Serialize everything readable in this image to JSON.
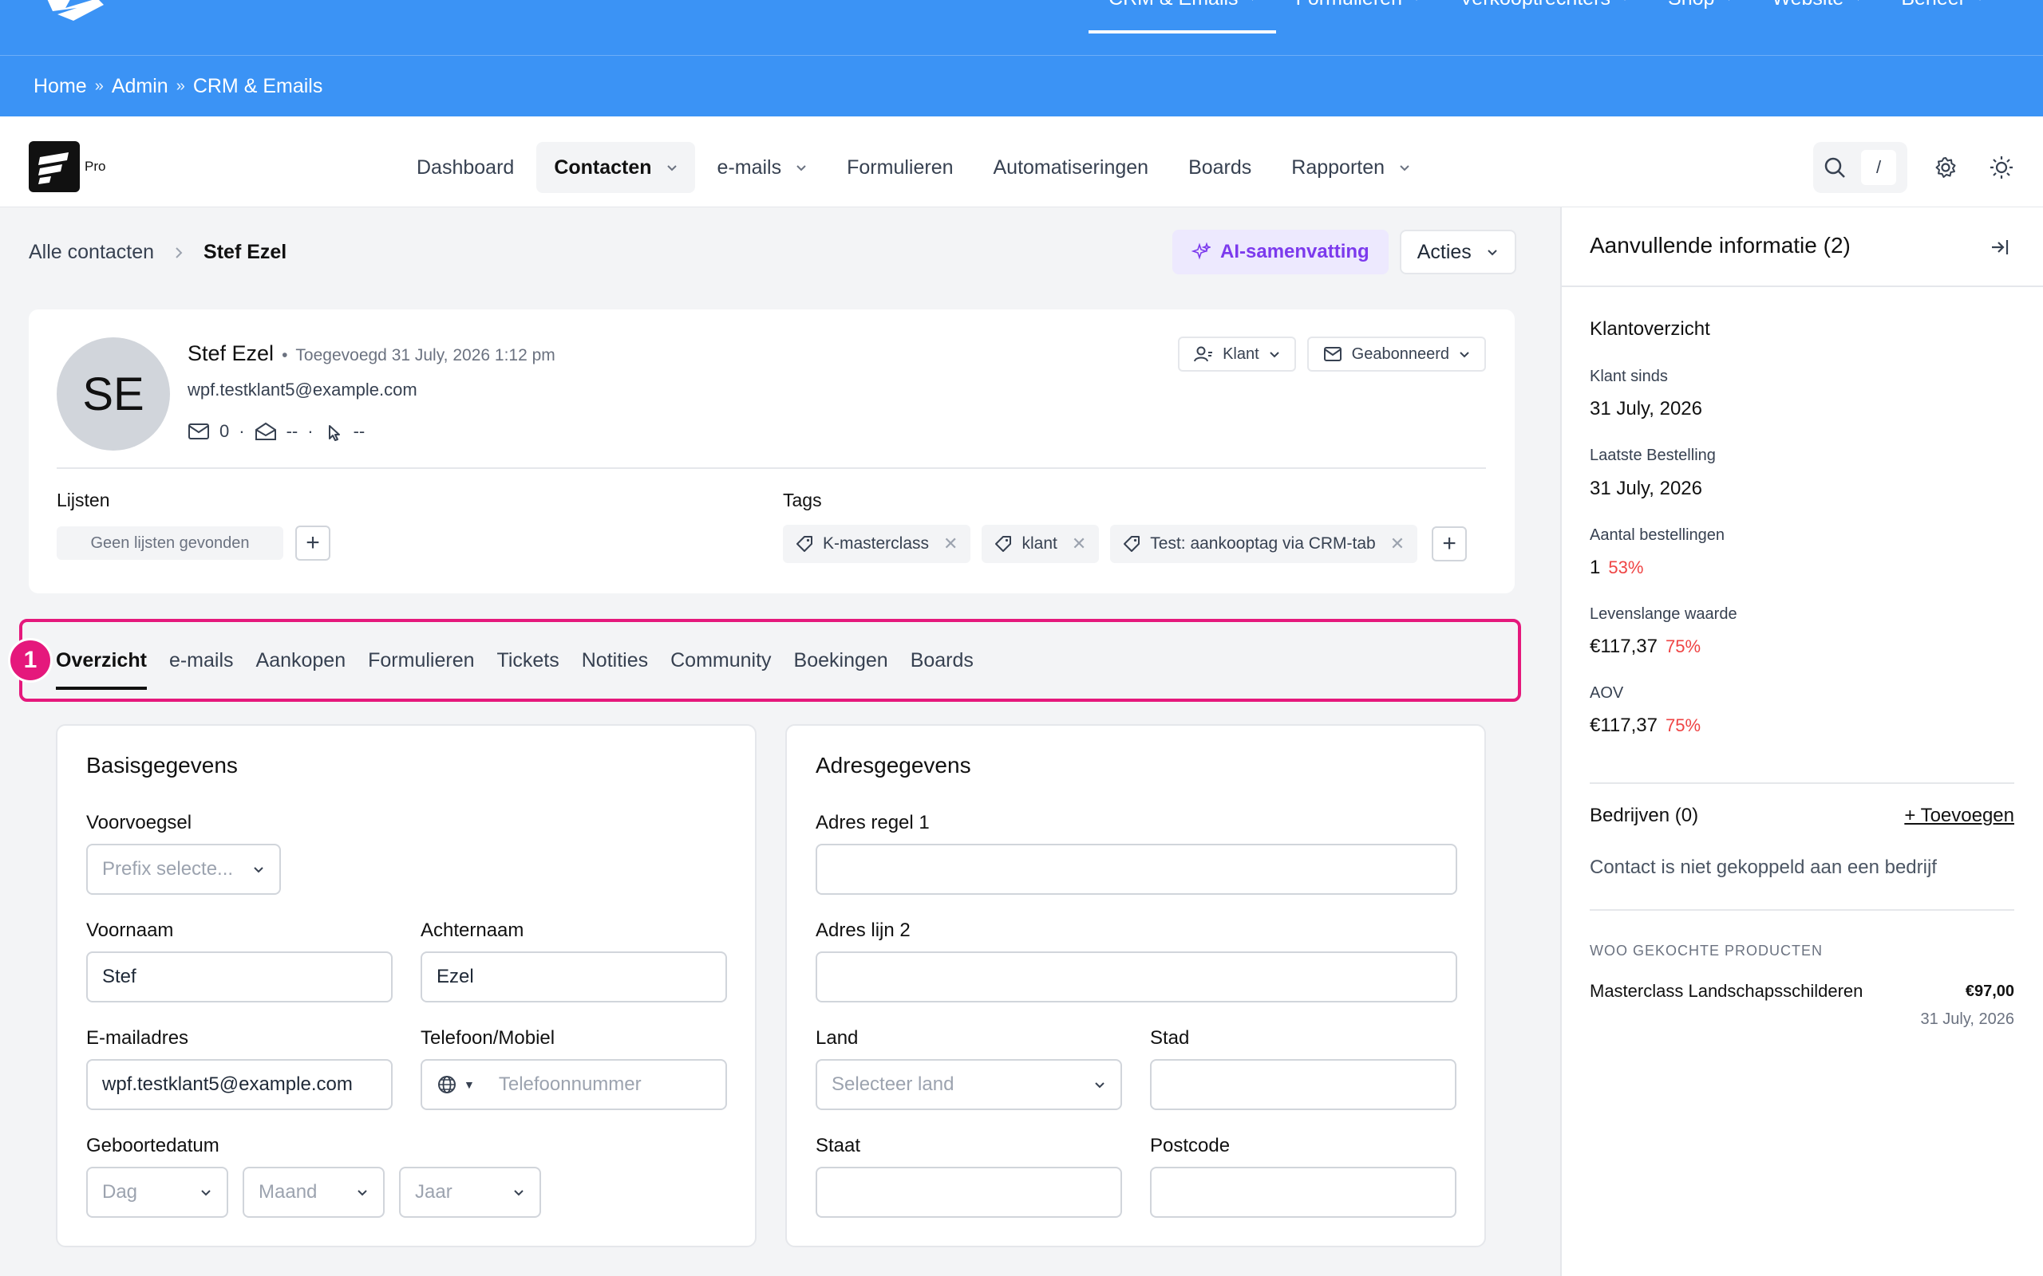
{
  "topnav": {
    "items": [
      {
        "label": "CRM & Emails",
        "active": true
      },
      {
        "label": "Formulieren"
      },
      {
        "label": "Verkooptrechters"
      },
      {
        "label": "Shop"
      },
      {
        "label": "Website"
      },
      {
        "label": "Beheer"
      }
    ]
  },
  "breadcrumb_bar": {
    "items": [
      "Home",
      "Admin",
      "CRM & Emails"
    ],
    "sep": "»"
  },
  "app": {
    "brand_suffix": "Pro",
    "nav": [
      {
        "label": "Dashboard"
      },
      {
        "label": "Contacten",
        "active": true
      },
      {
        "label": "e-mails"
      },
      {
        "label": "Formulieren"
      },
      {
        "label": "Automatiseringen"
      },
      {
        "label": "Boards"
      },
      {
        "label": "Rapporten"
      }
    ],
    "search_kbd": "/"
  },
  "page": {
    "crumb_parent": "Alle contacten",
    "crumb_current": "Stef Ezel",
    "ai_button": "AI-samenvatting",
    "actions_button": "Acties"
  },
  "contact": {
    "initials": "SE",
    "name": "Stef Ezel",
    "added": "Toegevoegd 31 July, 2026 1:12 pm",
    "email": "wpf.testklant5@example.com",
    "stat_emails": "0",
    "stat_opened": "--",
    "stat_clicked": "--",
    "status_pill": "Klant",
    "subscription_pill": "Geabonneerd",
    "lists_label": "Lijsten",
    "no_lists": "Geen lijsten gevonden",
    "tags_label": "Tags",
    "tags": [
      "K-masterclass",
      "klant",
      "Test: aankooptag via CRM-tab"
    ]
  },
  "tabs": {
    "badge": "1",
    "items": [
      "Overzicht",
      "e-mails",
      "Aankopen",
      "Formulieren",
      "Tickets",
      "Notities",
      "Community",
      "Boekingen",
      "Boards"
    ]
  },
  "basic": {
    "title": "Basisgegevens",
    "prefix_label": "Voorvoegsel",
    "prefix_placeholder": "Prefix selecte...",
    "first_label": "Voornaam",
    "first_value": "Stef",
    "last_label": "Achternaam",
    "last_value": "Ezel",
    "email_label": "E-mailadres",
    "email_value": "wpf.testklant5@example.com",
    "phone_label": "Telefoon/Mobiel",
    "phone_placeholder": "Telefoonnummer",
    "dob_label": "Geboortedatum",
    "dob_day": "Dag",
    "dob_month": "Maand",
    "dob_year": "Jaar"
  },
  "address": {
    "title": "Adresgegevens",
    "line1_label": "Adres regel 1",
    "line2_label": "Adres lijn 2",
    "country_label": "Land",
    "country_placeholder": "Selecteer land",
    "city_label": "Stad",
    "state_label": "Staat",
    "zip_label": "Postcode"
  },
  "panel": {
    "title": "Aanvullende informatie (2)",
    "overview_title": "Klantoverzicht",
    "customer_since_label": "Klant sinds",
    "customer_since": "31 July, 2026",
    "last_order_label": "Laatste Bestelling",
    "last_order": "31 July, 2026",
    "orders_label": "Aantal bestellingen",
    "orders": "1",
    "orders_pct": "53%",
    "ltv_label": "Levenslange waarde",
    "ltv": "€117,37",
    "ltv_pct": "75%",
    "aov_label": "AOV",
    "aov": "€117,37",
    "aov_pct": "75%",
    "companies_title": "Bedrijven (0)",
    "companies_add": "+ Toevoegen",
    "companies_empty": "Contact is niet gekoppeld aan een bedrijf",
    "woo_title": "WOO GEKOCHTE PRODUCTEN",
    "product_name": "Masterclass Landschapsschilderen",
    "product_price": "€97,00",
    "product_date": "31 July, 2026"
  },
  "colors": {
    "topbar": "#3b93f5",
    "highlight": "#e5187c",
    "ai": "#7c3aed",
    "pct": "#ef4444"
  }
}
